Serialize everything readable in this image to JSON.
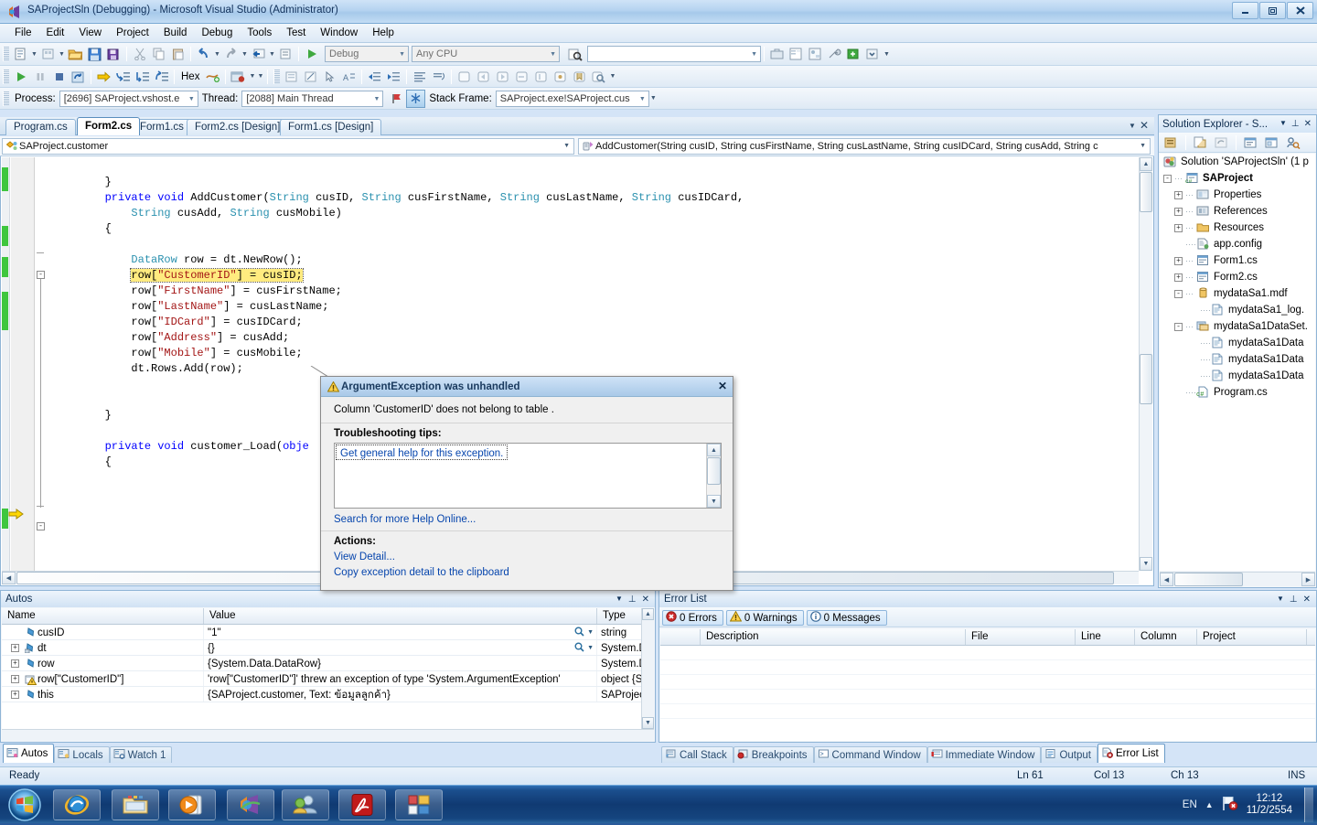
{
  "window": {
    "title": "SAProjectSln (Debugging) - Microsoft Visual Studio (Administrator)",
    "minimize": "—",
    "maximize": "❐",
    "close": "✕"
  },
  "menu": {
    "items": [
      "File",
      "Edit",
      "View",
      "Project",
      "Build",
      "Debug",
      "Tools",
      "Test",
      "Window",
      "Help"
    ]
  },
  "toolbar": {
    "config_value": "Debug",
    "platform_value": "Any CPU",
    "find_value": "",
    "hex_label": "Hex"
  },
  "debugbar": {
    "process_label": "Process:",
    "process_value": "[2696] SAProject.vshost.e",
    "thread_label": "Thread:",
    "thread_value": "[2088] Main Thread",
    "stackframe_label": "Stack Frame:",
    "stackframe_value": "SAProject.exe!SAProject.cus"
  },
  "doctabs": {
    "tabs": [
      {
        "label": "Program.cs",
        "active": false
      },
      {
        "label": "Form2.cs",
        "active": true
      },
      {
        "label": "Form1.cs",
        "active": false
      },
      {
        "label": "Form2.cs [Design]",
        "active": false
      },
      {
        "label": "Form1.cs [Design]",
        "active": false
      }
    ]
  },
  "navbar": {
    "class_value": "SAProject.customer",
    "member_value": "AddCustomer(String cusID, String cusFirstName, String cusLastName, String cusIDCard, String cusAdd, String c"
  },
  "code": {
    "lines": [
      "        }",
      "        private void AddCustomer(String cusID, String cusFirstName, String cusLastName, String cusIDCard,",
      "            String cusAdd, String cusMobile)",
      "        {",
      "",
      "            DataRow row = dt.NewRow();",
      "            row[\"CustomerID\"] = cusID;",
      "            row[\"FirstName\"] = cusFirstName;",
      "            row[\"LastName\"] = cusLastName;",
      "            row[\"IDCard\"] = cusIDCard;",
      "            row[\"Address\"] = cusAdd;",
      "            row[\"Mobile\"] = cusMobile;",
      "            dt.Rows.Add(row);",
      "",
      "",
      "        }",
      "",
      "        private void customer_Load(object sender, EventArgs e)",
      "        {"
    ],
    "highlighted_line": "row[\"CustomerID\"] = cusID;"
  },
  "exception_dialog": {
    "title": "ArgumentException was unhandled",
    "close": "✕",
    "message": "Column 'CustomerID' does not belong to table .",
    "tips_header": "Troubleshooting tips:",
    "tips": [
      "Get general help for this exception."
    ],
    "search_link": "Search for more Help Online...",
    "actions_header": "Actions:",
    "actions": [
      "View Detail...",
      "Copy exception detail to the clipboard"
    ]
  },
  "solution_explorer": {
    "title": "Solution Explorer - S...",
    "pin": "⊥",
    "close": "✕",
    "tree": [
      {
        "label": "Solution 'SAProjectSln' (1 p",
        "depth": 0,
        "expander": "",
        "icon": "solution-icon",
        "bold": false
      },
      {
        "label": "SAProject",
        "depth": 0,
        "expander": "-",
        "icon": "csproject-icon",
        "bold": true
      },
      {
        "label": "Properties",
        "depth": 1,
        "expander": "+",
        "icon": "properties-icon",
        "bold": false
      },
      {
        "label": "References",
        "depth": 1,
        "expander": "+",
        "icon": "references-icon",
        "bold": false
      },
      {
        "label": "Resources",
        "depth": 1,
        "expander": "+",
        "icon": "folder-icon",
        "bold": false
      },
      {
        "label": "app.config",
        "depth": 1,
        "expander": "",
        "icon": "config-icon",
        "bold": false
      },
      {
        "label": "Form1.cs",
        "depth": 1,
        "expander": "+",
        "icon": "form-icon",
        "bold": false
      },
      {
        "label": "Form2.cs",
        "depth": 1,
        "expander": "+",
        "icon": "form-icon",
        "bold": false
      },
      {
        "label": "mydataSa1.mdf",
        "depth": 1,
        "expander": "-",
        "icon": "database-icon",
        "bold": false
      },
      {
        "label": "mydataSa1_log.",
        "depth": 2,
        "expander": "",
        "icon": "file-icon",
        "bold": false
      },
      {
        "label": "mydataSa1DataSet.",
        "depth": 1,
        "expander": "-",
        "icon": "dataset-icon",
        "bold": false
      },
      {
        "label": "mydataSa1Data",
        "depth": 2,
        "expander": "",
        "icon": "file-icon",
        "bold": false
      },
      {
        "label": "mydataSa1Data",
        "depth": 2,
        "expander": "",
        "icon": "file-icon",
        "bold": false
      },
      {
        "label": "mydataSa1Data",
        "depth": 2,
        "expander": "",
        "icon": "file-icon",
        "bold": false
      },
      {
        "label": "Program.cs",
        "depth": 1,
        "expander": "",
        "icon": "cs-icon",
        "bold": false
      }
    ]
  },
  "autos": {
    "title": "Autos",
    "columns": [
      "Name",
      "Value",
      "Type"
    ],
    "rows": [
      {
        "name": "cusID",
        "value": "\"1\"",
        "type": "string",
        "expandable": false,
        "magnifier": true,
        "icon": "field-icon"
      },
      {
        "name": "dt",
        "value": "{}",
        "type": "System.D",
        "expandable": true,
        "magnifier": true,
        "icon": "field-icon"
      },
      {
        "name": "row",
        "value": "{System.Data.DataRow}",
        "type": "System.D",
        "expandable": true,
        "magnifier": false,
        "icon": "field-icon"
      },
      {
        "name": "row[\"CustomerID\"]",
        "value": "'row[\"CustomerID\"]' threw an exception of type 'System.ArgumentException'",
        "type": "object {S",
        "expandable": true,
        "magnifier": false,
        "icon": "exception-icon"
      },
      {
        "name": "this",
        "value": "{SAProject.customer, Text: ข้อมูลลูกค้า}",
        "type": "SAProject",
        "expandable": true,
        "magnifier": false,
        "icon": "field-icon"
      }
    ]
  },
  "error_list": {
    "title": "Error List",
    "filters": [
      {
        "label": "0 Errors",
        "icon": "error-icon"
      },
      {
        "label": "0 Warnings",
        "icon": "warning-icon"
      },
      {
        "label": "0 Messages",
        "icon": "info-icon"
      }
    ],
    "columns": [
      "Description",
      "File",
      "Line",
      "Column",
      "Project"
    ]
  },
  "left_bottom_tabs": [
    {
      "label": "Autos",
      "active": true
    },
    {
      "label": "Locals",
      "active": false
    },
    {
      "label": "Watch 1",
      "active": false
    }
  ],
  "right_bottom_tabs": [
    {
      "label": "Call Stack",
      "active": false
    },
    {
      "label": "Breakpoints",
      "active": false
    },
    {
      "label": "Command Window",
      "active": false
    },
    {
      "label": "Immediate Window",
      "active": false
    },
    {
      "label": "Output",
      "active": false
    },
    {
      "label": "Error List",
      "active": true
    }
  ],
  "statusbar": {
    "state": "Ready",
    "line": "Ln 61",
    "col": "Col 13",
    "ch": "Ch 13",
    "insert": "INS"
  },
  "taskbar": {
    "buttons": [
      "internet-explorer-icon",
      "explorer-icon",
      "media-player-icon",
      "visual-studio-icon",
      "messenger-icon",
      "acrobat-reader-icon",
      "app-icon"
    ],
    "language": "EN",
    "time": "12:12",
    "date": "11/2/2554"
  },
  "colors": {
    "accent": "#2f6fb5",
    "keyword": "#0000ff",
    "type": "#2b91af",
    "string": "#a31515",
    "highlight": "#ffeb7f",
    "changebar": "#3ec63e"
  }
}
